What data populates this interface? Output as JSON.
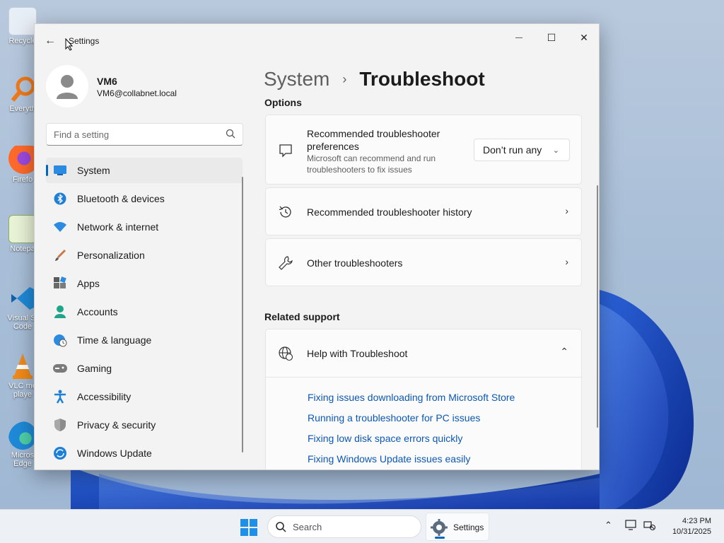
{
  "window": {
    "app_title": "Settings",
    "back_glyph": "←",
    "minimize_glyph": "—",
    "maximize_glyph": "☐",
    "close_glyph": "✕"
  },
  "profile": {
    "name": "VM6",
    "email": "VM6@collabnet.local"
  },
  "search": {
    "placeholder": "Find a setting"
  },
  "nav": {
    "items": [
      {
        "label": "System",
        "icon": "monitor-icon",
        "active": true
      },
      {
        "label": "Bluetooth & devices",
        "icon": "bluetooth-icon"
      },
      {
        "label": "Network & internet",
        "icon": "wifi-icon"
      },
      {
        "label": "Personalization",
        "icon": "brush-icon"
      },
      {
        "label": "Apps",
        "icon": "apps-icon"
      },
      {
        "label": "Accounts",
        "icon": "person-icon"
      },
      {
        "label": "Time & language",
        "icon": "globe-clock-icon"
      },
      {
        "label": "Gaming",
        "icon": "gamepad-icon"
      },
      {
        "label": "Accessibility",
        "icon": "accessibility-icon"
      },
      {
        "label": "Privacy & security",
        "icon": "shield-icon"
      },
      {
        "label": "Windows Update",
        "icon": "update-icon"
      }
    ]
  },
  "breadcrumb": {
    "parent": "System",
    "separator": "›",
    "current": "Troubleshoot"
  },
  "options": {
    "heading": "Options",
    "preferences": {
      "title": "Recommended troubleshooter preferences",
      "description": "Microsoft can recommend and run troubleshooters to fix issues",
      "dropdown_value": "Don’t run any"
    },
    "history": {
      "title": "Recommended troubleshooter history"
    },
    "other": {
      "title": "Other troubleshooters"
    }
  },
  "related": {
    "heading": "Related support",
    "help": {
      "title": "Help with Troubleshoot",
      "links": [
        "Fixing issues downloading from Microsoft Store",
        "Running a troubleshooter for PC issues",
        "Fixing low disk space errors quickly",
        "Fixing Windows Update issues easily"
      ]
    }
  },
  "desktop": {
    "icons": [
      "Recycle",
      "Everyth",
      "Firefo",
      "Notepa",
      "Visual St Code",
      "VLC me playe",
      "Micros Edge"
    ]
  },
  "taskbar": {
    "search_placeholder": "Search",
    "app_label": "Settings",
    "time": "4:23 PM",
    "date": "10/31/2025"
  },
  "colors": {
    "accent": "#0067c0",
    "link": "#0b57b5",
    "window_bg": "#f3f3f3"
  }
}
